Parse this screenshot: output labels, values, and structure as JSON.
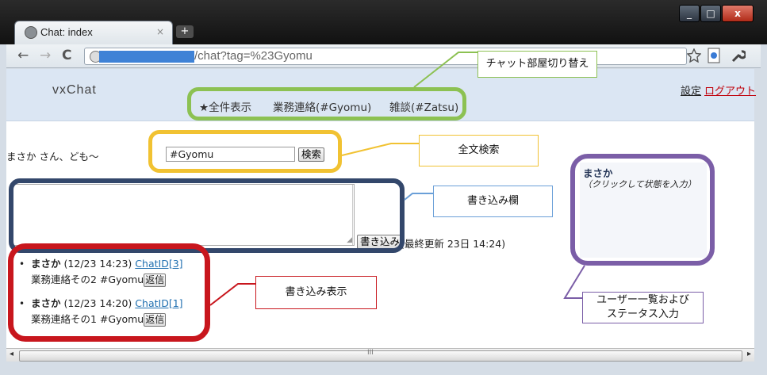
{
  "browser": {
    "tab_title": "Chat: index",
    "tab_close": "×",
    "new_tab": "+",
    "url_path": "/chat?tag=%23Gyomu",
    "nav": {
      "back": "←",
      "forward": "→",
      "reload": "C"
    },
    "window_buttons": {
      "minimize": "_",
      "maximize": "□",
      "close": "x"
    }
  },
  "app": {
    "name": "vxChat",
    "nav_links": [
      "★全件表示",
      "業務連絡(#Gyomu)",
      "雑談(#Zatsu)"
    ],
    "settings": "設定",
    "logout": "ログアウト",
    "greeting": "まさか さん、ども〜",
    "search_value": "#Gyomu",
    "search_button": "検索",
    "post_button": "書き込み",
    "last_update": "(最終更新 23日 14:24)"
  },
  "messages": [
    {
      "user": "まさか",
      "time": "(12/23 14:23)",
      "chat_id": "ChatID[3]",
      "body": "業務連絡その2 #Gyomu",
      "reply": "返信"
    },
    {
      "user": "まさか",
      "time": "(12/23 14:20)",
      "chat_id": "ChatID[1]",
      "body": "業務連絡その1 #Gyomu",
      "reply": "返信"
    }
  ],
  "user_panel": {
    "user": "まさか",
    "status_hint": "（クリックして状態を入力）"
  },
  "annotations": {
    "room_switch": "チャット部屋切り替え",
    "full_text_search": "全文検索",
    "input_field": "書き込み欄",
    "post_display": "書き込み表示",
    "user_list": "ユーザー一覧およびステータス入力"
  },
  "colors": {
    "green": "#8cc152",
    "yellow": "#f1c232",
    "navy": "#33476b",
    "red": "#c8161d",
    "purple": "#7b5ea7",
    "blue_callout": "#6a9fd8"
  }
}
